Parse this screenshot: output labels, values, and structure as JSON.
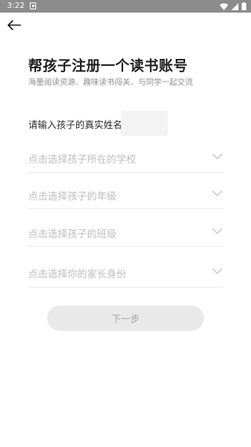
{
  "status_bar": {
    "time": "3:22",
    "icons": [
      "notification-icon",
      "wifi-icon",
      "signal-icon",
      "battery-icon"
    ]
  },
  "header": {
    "back_icon": "arrow-left-icon"
  },
  "main": {
    "title": "帮孩子注册一个读书账号",
    "subtitle": "海量阅读资源、趣味读书闯关、与同学一起交流",
    "name_label": "请输入孩子的真实姓名",
    "name_value": "",
    "selects": [
      {
        "placeholder": "点击选择孩子所在的学校",
        "icon": "chevron-down-icon"
      },
      {
        "placeholder": "点击选择孩子的年级",
        "icon": "chevron-down-icon"
      },
      {
        "placeholder": "点击选择孩子的班级",
        "icon": "chevron-down-icon"
      },
      {
        "placeholder": "点击选择你的家长身份",
        "icon": "chevron-down-icon"
      }
    ],
    "next_label": "下一步"
  },
  "colors": {
    "status_bar": "#8c8c8c",
    "placeholder": "#bdbdbd",
    "button_bg": "#e9e9e9",
    "button_text": "#a3a3a3"
  }
}
